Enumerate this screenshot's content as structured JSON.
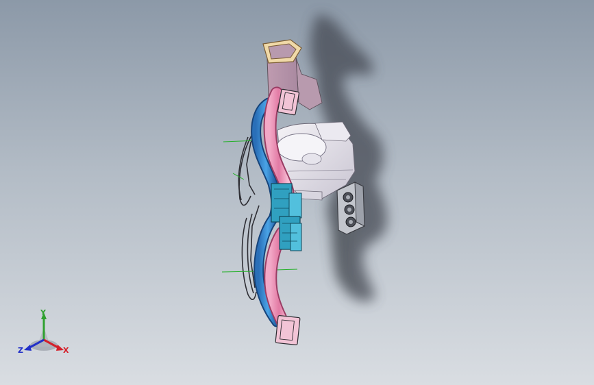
{
  "viewport": {
    "background_top": "#8c99a8",
    "background_bottom": "#d9dde2"
  },
  "model": {
    "parts": [
      {
        "id": "inlet-duct",
        "color": "#c9a3ba"
      },
      {
        "id": "left-duct",
        "color": "#e98fb3"
      },
      {
        "id": "right-duct",
        "color": "#3d8ed1"
      },
      {
        "id": "blower-housing",
        "color": "#e4e2ea"
      },
      {
        "id": "vent-outlets",
        "color": "#35a8c7"
      },
      {
        "id": "control-panel",
        "color": "#b9bcc4"
      },
      {
        "id": "bracket-frame",
        "color": "#2e2e34"
      }
    ],
    "shadow_color": "#3c4148"
  },
  "triad": {
    "x_label": "X",
    "y_label": "Y",
    "z_label": "Z",
    "x_color": "#d4202a",
    "y_color": "#2fa12f",
    "z_color": "#2230c8"
  }
}
